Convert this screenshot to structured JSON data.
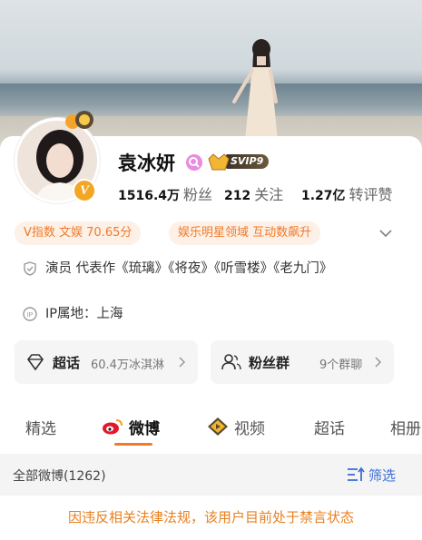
{
  "profile": {
    "name": "袁冰妍",
    "svip_label": "SVIP9",
    "followers": {
      "value": "1516.4万",
      "label": "粉丝"
    },
    "following": {
      "value": "212",
      "label": "关注"
    },
    "reposts": {
      "value": "1.27亿",
      "label": "转评赞"
    }
  },
  "pills": [
    {
      "text": "V指数 文娱 70.65分"
    },
    {
      "text": "娱乐明星领域 互动数飙升"
    }
  ],
  "info": {
    "bio": "演员 代表作《琉璃》《将夜》《听雪楼》《老九门》",
    "ip_location": "IP属地：上海"
  },
  "boxes": {
    "supertopic": {
      "title": "超话",
      "sub": "60.4万冰淇淋"
    },
    "fan_group": {
      "title": "粉丝群",
      "sub": "9个群聊"
    }
  },
  "tabs": [
    "精选",
    "微博",
    "视频",
    "超话",
    "相册"
  ],
  "active_tab": "微博",
  "filter": {
    "title": "全部微博(1262)",
    "button_label": "筛选"
  },
  "notice": "因违反相关法律法规，该用户目前处于禁言状态",
  "colors": {
    "accent": "#f07a2a",
    "link": "#3b6fd8",
    "verified": "#f3a623"
  },
  "icons": {
    "verified": "verified-v-icon",
    "search": "search-badge-icon",
    "shield": "shield-icon",
    "ip": "ip-icon",
    "diamond": "supertopic-diamond-icon",
    "people": "fans-group-icon",
    "weibo": "weibo-logo-icon",
    "video": "video-icon",
    "filter": "filter-icon"
  }
}
